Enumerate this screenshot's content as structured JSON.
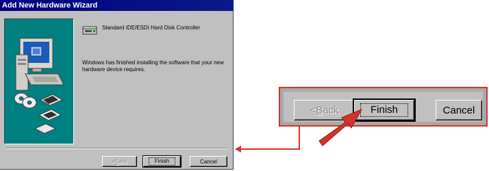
{
  "window": {
    "title": "Add New Hardware Wizard"
  },
  "device": {
    "name": "Standard IDE/ESDI Hard Disk Controller",
    "icon": "hard-disk-controller-icon"
  },
  "message": "Windows has finished installing the software that your new hardware device requires.",
  "buttons": {
    "back": {
      "prefix": "< ",
      "underlined": "B",
      "rest": "ack",
      "enabled": false
    },
    "finish": "Finish",
    "cancel": "Cancel"
  },
  "callout": {
    "border_color": "#d2332a",
    "arrow_color": "#d2332a"
  }
}
